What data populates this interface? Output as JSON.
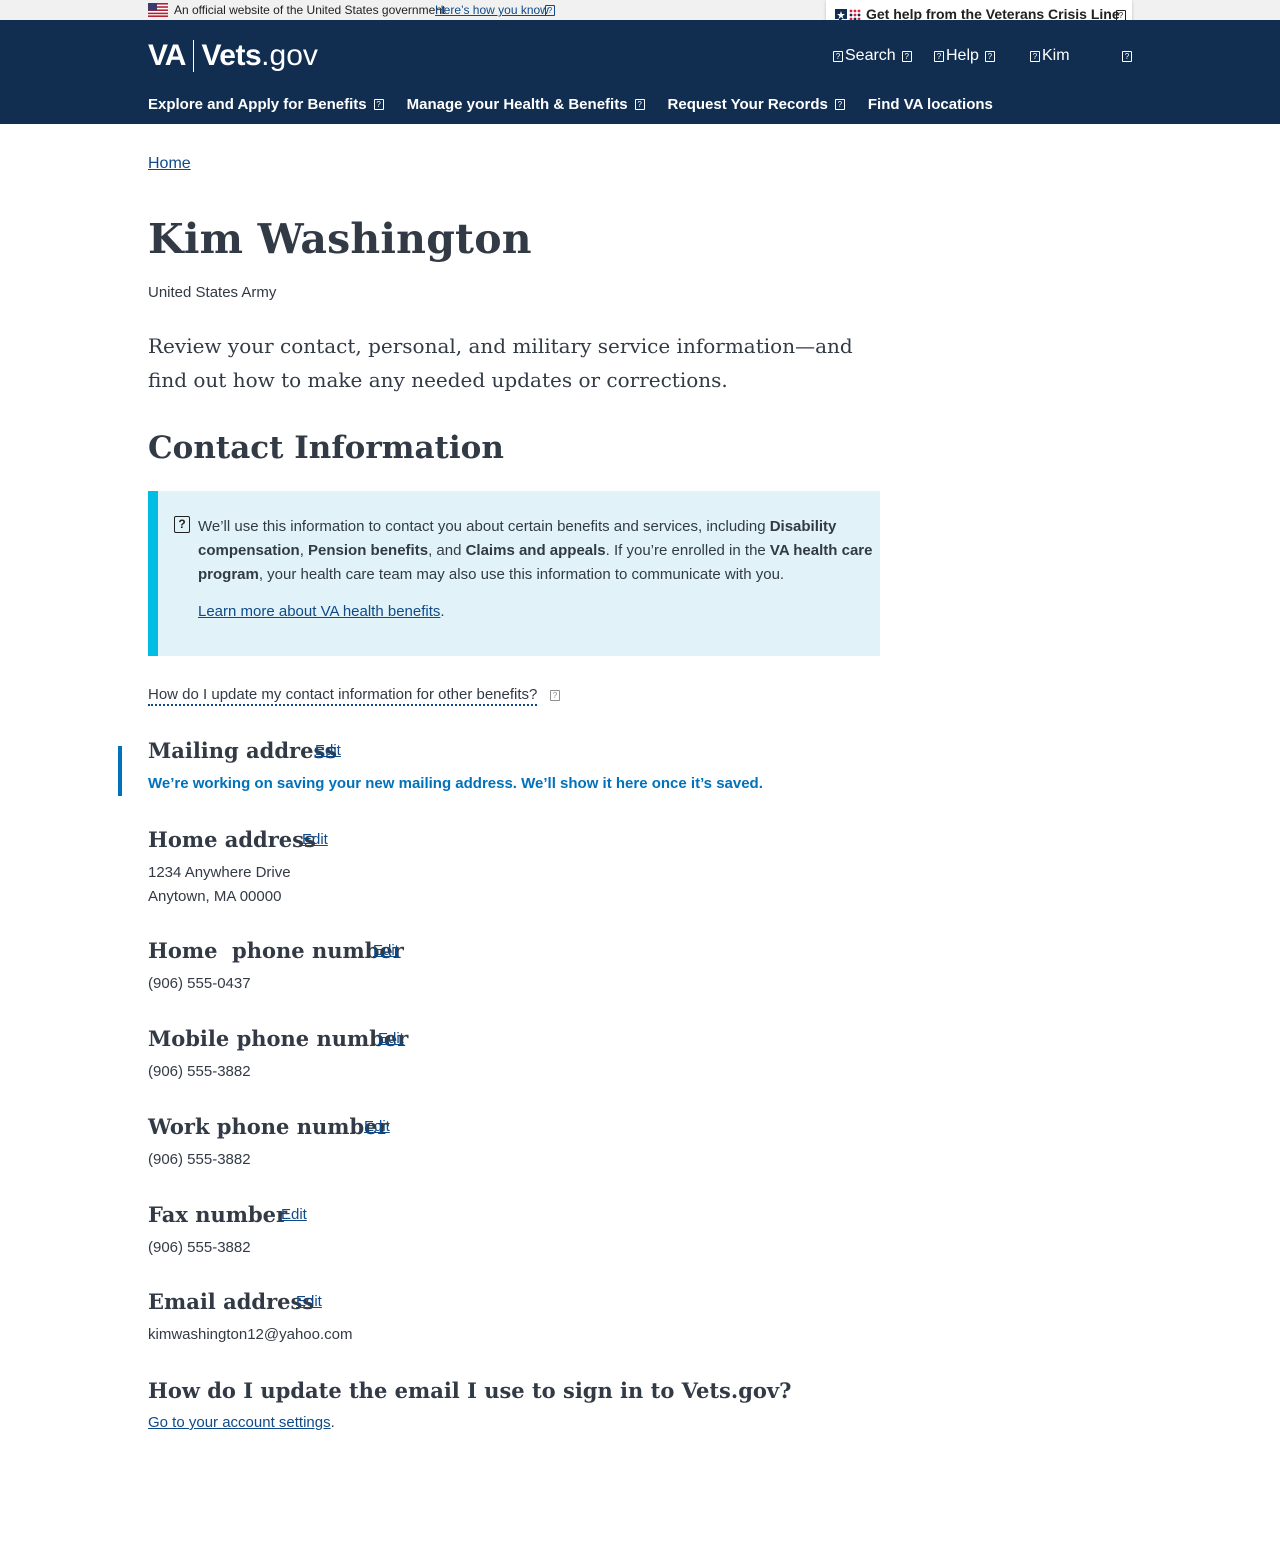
{
  "gov_banner": {
    "text": "An official website of the United States government",
    "link": "Here’s how you know"
  },
  "crisis_line": {
    "label": "Get help from the Veterans Crisis Line"
  },
  "header": {
    "logo_va": "VA",
    "logo_vets": "Vets",
    "logo_gov": ".gov",
    "utility": {
      "search": "Search",
      "help": "Help",
      "user": "Kim"
    },
    "nav": [
      {
        "label": "Explore and Apply for Benefits",
        "has_menu": true
      },
      {
        "label": "Manage your Health & Benefits",
        "has_menu": true
      },
      {
        "label": "Request Your Records",
        "has_menu": true
      },
      {
        "label": "Find VA locations",
        "has_menu": false
      }
    ]
  },
  "breadcrumb": {
    "home": "Home"
  },
  "profile": {
    "name": "Kim Washington",
    "branch": "United States Army",
    "intro": "Review your contact, personal, and military service information—and find out how to make any needed updates or corrections."
  },
  "contact": {
    "heading": "Contact Information",
    "alert": {
      "t1": "We’ll use this information to contact you about certain benefits and services, including ",
      "b1": "Disability compensation",
      "t2": ", ",
      "b2": "Pension benefits",
      "t3": ", and ",
      "b3": "Claims and appeals",
      "t4": ". If you’re enrolled in the ",
      "b4": "VA health care program",
      "t5": ", your health care team may also use this information to communicate with you.",
      "link": "Learn more about VA health benefits",
      "link_suffix": "."
    },
    "accordion_question": "How do I update my contact information for other benefits?",
    "edit_label": "Edit",
    "mailing": {
      "title": "Mailing address",
      "status": "We’re working on saving your new mailing address. We’ll show it here once it’s saved."
    },
    "home_address": {
      "title": "Home address",
      "line1": "1234 Anywhere Drive",
      "line2": "Anytown, MA 00000"
    },
    "home_phone": {
      "title": "Home  phone number",
      "value": "(906) 555-0437"
    },
    "mobile_phone": {
      "title": "Mobile phone number",
      "value": "(906) 555-3882"
    },
    "work_phone": {
      "title": "Work phone number",
      "value": "(906) 555-3882"
    },
    "fax": {
      "title": "Fax number",
      "value": "(906) 555-3882"
    },
    "email": {
      "title": "Email address",
      "value": "kimwashington12@yahoo.com"
    },
    "signin": {
      "question": "How do I update the email I use to sign in to Vets.gov?",
      "link": "Go to your account settings",
      "suffix": "."
    }
  },
  "colors": {
    "header_bg": "#112e51",
    "link": "#0e4a8a",
    "alert_bg": "#e1f3f8",
    "alert_border": "#00bde3",
    "status_text": "#0071bb"
  }
}
